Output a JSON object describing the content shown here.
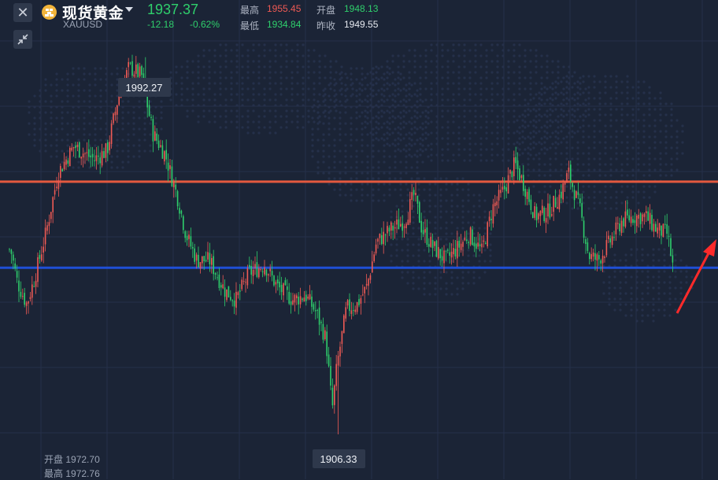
{
  "header": {
    "close_icon": "close-icon",
    "shrink_icon": "shrink-icon",
    "title": "现货黄金",
    "symbol": "XAUUSD",
    "price": "1937.37",
    "change": "-12.18",
    "change_pct": "-0.62%",
    "stats": {
      "high_label": "最高",
      "high": "1955.45",
      "open_label": "开盘",
      "open": "1948.13",
      "low_label": "最低",
      "low": "1934.84",
      "prev_close_label": "昨收",
      "prev_close": "1949.55"
    }
  },
  "bottom_info": {
    "open_label": "开盘",
    "open": "1972.70",
    "high_label": "最高",
    "high": "1972.76"
  },
  "colors": {
    "background": "#1b2436",
    "up": "#ef5a54",
    "down": "#2fcf6c",
    "resistance_line": "#e4593f",
    "support_line": "#1f4fd6",
    "arrow": "#ff2a2a"
  },
  "chart_data": {
    "type": "candlestick",
    "ylim": [
      1896.1,
      2005.3
    ],
    "max_label": "1992.27",
    "min_label": "1906.33",
    "max_value": 1992.27,
    "min_value": 1906.33,
    "horizontal_lines": [
      {
        "value": 1963.9,
        "color": "#e4593f"
      },
      {
        "value": 1944.3,
        "color": "#1f4fd6"
      }
    ],
    "annotation_arrow": "up-right",
    "close_path": [
      [
        0,
        1951
      ],
      [
        14,
        1948
      ],
      [
        22,
        1941
      ],
      [
        34,
        1936
      ],
      [
        44,
        1942
      ],
      [
        58,
        1952
      ],
      [
        74,
        1966
      ],
      [
        94,
        1972
      ],
      [
        110,
        1970
      ],
      [
        120,
        1969
      ],
      [
        136,
        1971
      ],
      [
        150,
        1983
      ],
      [
        164,
        1990
      ],
      [
        180,
        1988
      ],
      [
        194,
        1975
      ],
      [
        210,
        1970
      ],
      [
        226,
        1960
      ],
      [
        236,
        1952
      ],
      [
        250,
        1946
      ],
      [
        266,
        1946
      ],
      [
        286,
        1939
      ],
      [
        300,
        1937
      ],
      [
        316,
        1943
      ],
      [
        336,
        1945
      ],
      [
        352,
        1940
      ],
      [
        372,
        1937
      ],
      [
        388,
        1938
      ],
      [
        402,
        1934
      ],
      [
        414,
        1928
      ],
      [
        422,
        1912
      ],
      [
        428,
        1922
      ],
      [
        440,
        1935
      ],
      [
        454,
        1936
      ],
      [
        466,
        1940
      ],
      [
        478,
        1950
      ],
      [
        496,
        1953
      ],
      [
        514,
        1955
      ],
      [
        526,
        1961
      ],
      [
        536,
        1953
      ],
      [
        550,
        1949
      ],
      [
        566,
        1946
      ],
      [
        582,
        1949
      ],
      [
        596,
        1952
      ],
      [
        612,
        1948
      ],
      [
        626,
        1958
      ],
      [
        640,
        1962
      ],
      [
        654,
        1968
      ],
      [
        666,
        1963
      ],
      [
        680,
        1956
      ],
      [
        696,
        1957
      ],
      [
        712,
        1961
      ],
      [
        722,
        1966
      ],
      [
        736,
        1958
      ],
      [
        748,
        1947
      ],
      [
        760,
        1946
      ],
      [
        774,
        1950
      ],
      [
        790,
        1955
      ],
      [
        806,
        1956
      ],
      [
        820,
        1956
      ],
      [
        834,
        1953
      ],
      [
        848,
        1952
      ],
      [
        855,
        1944
      ]
    ]
  }
}
